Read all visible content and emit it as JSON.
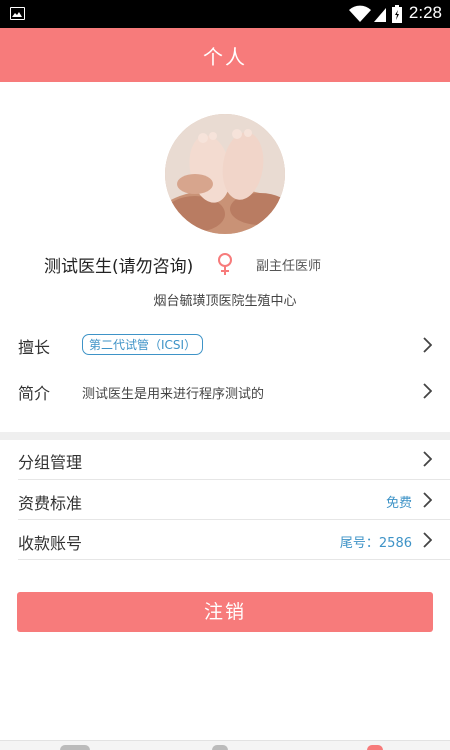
{
  "status_bar": {
    "time": "2:28"
  },
  "header": {
    "title": "个人"
  },
  "profile": {
    "name": "测试医生(请勿咨询)",
    "gender_icon": "female-icon",
    "title": "副主任医师",
    "hospital": "烟台毓璜顶医院生殖中心"
  },
  "specialty": {
    "label": "擅长",
    "tag": "第二代试管（ICSI）"
  },
  "intro": {
    "label": "简介",
    "text": "测试医生是用来进行程序测试的"
  },
  "menu": [
    {
      "label": "分组管理",
      "value": ""
    },
    {
      "label": "资费标准",
      "value": "免费"
    },
    {
      "label": "收款账号",
      "value": "尾号：2586"
    }
  ],
  "logout_label": "注销",
  "colors": {
    "accent": "#f77b7b",
    "link": "#3e93c7"
  }
}
